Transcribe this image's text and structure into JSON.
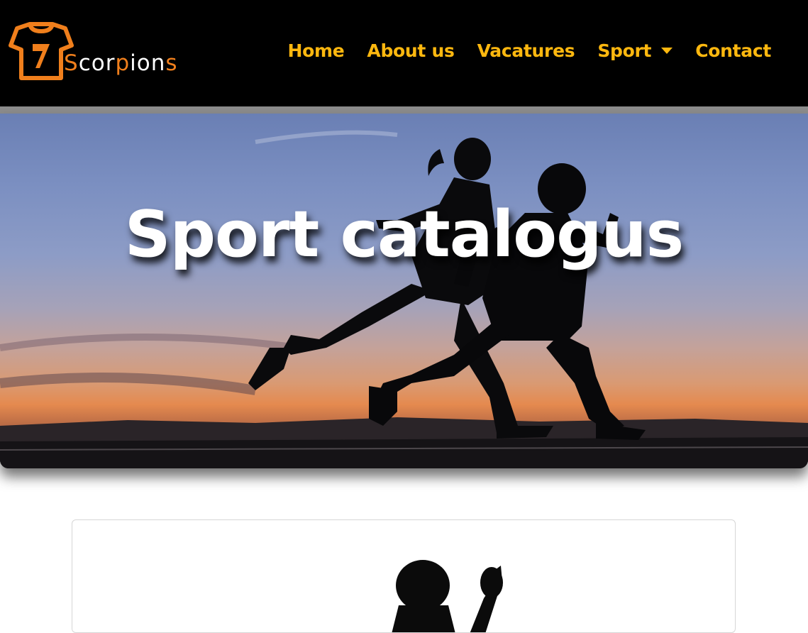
{
  "brand": {
    "logo_text": "Scorpions",
    "shirt_number": "7",
    "accent_color": "#f07f1c"
  },
  "nav": {
    "link_color": "#ffb80f",
    "items": [
      {
        "label": "Home"
      },
      {
        "label": "About us"
      },
      {
        "label": "Vacatures"
      },
      {
        "label": "Sport",
        "dropdown": true
      },
      {
        "label": "Contact"
      }
    ]
  },
  "hero": {
    "title": "Sport catalogus",
    "image": "silhouettes-running-at-sunset"
  },
  "card": {
    "image": "athlete-silhouette-arm-raised"
  }
}
